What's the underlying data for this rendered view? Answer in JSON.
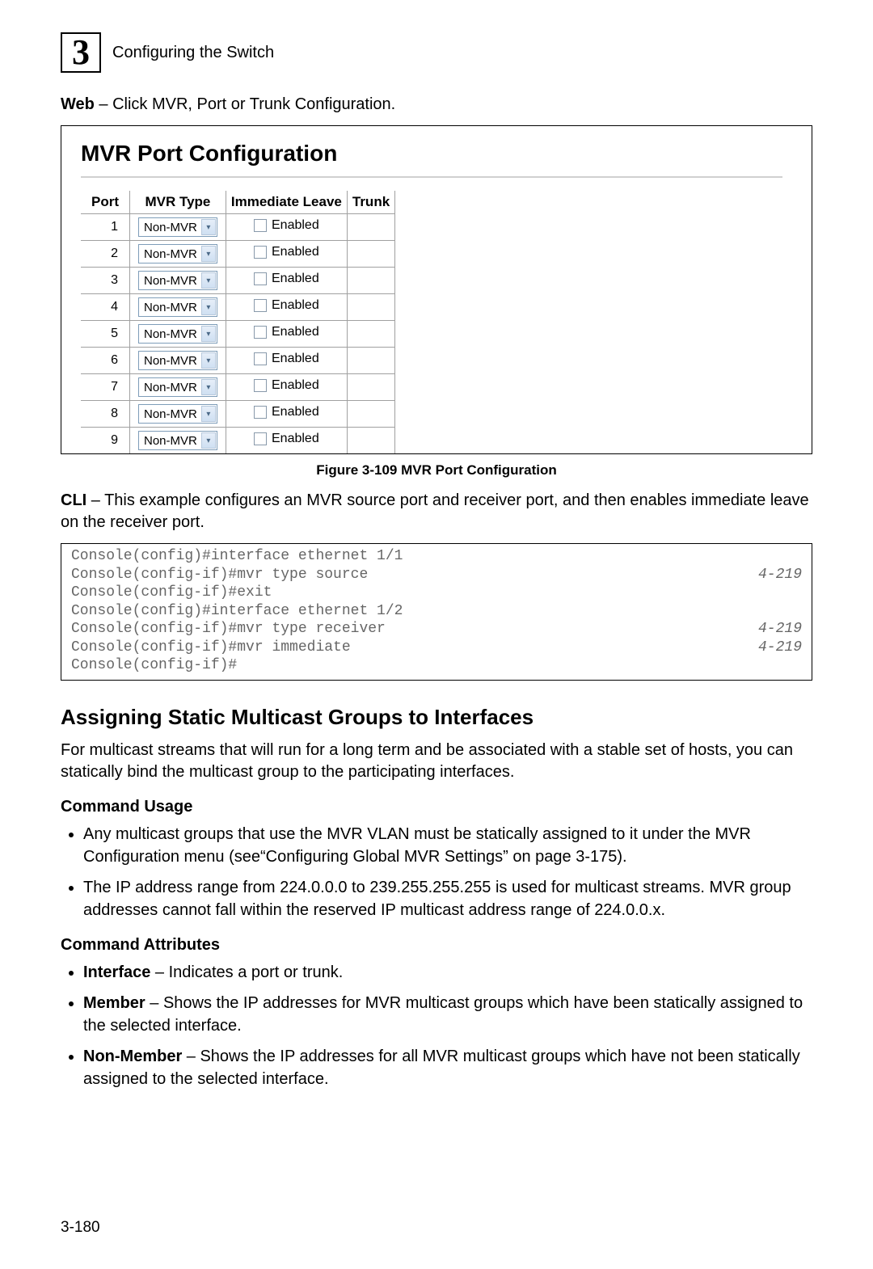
{
  "chapter_number": "3",
  "chapter_title": "Configuring the Switch",
  "web_line_bold": "Web",
  "web_line_rest": " – Click MVR, Port or Trunk Configuration.",
  "screenshot": {
    "title": "MVR Port Configuration",
    "headers": [
      "Port",
      "MVR Type",
      "Immediate Leave",
      "Trunk"
    ],
    "select_value": "Non-MVR",
    "checkbox_label": "Enabled",
    "rows": [
      {
        "port": "1"
      },
      {
        "port": "2"
      },
      {
        "port": "3"
      },
      {
        "port": "4"
      },
      {
        "port": "5"
      },
      {
        "port": "6"
      },
      {
        "port": "7"
      },
      {
        "port": "8"
      },
      {
        "port": "9"
      }
    ]
  },
  "figure_caption": "Figure 3-109  MVR Port Configuration",
  "cli_line_bold": "CLI",
  "cli_line_rest": " – This example configures an MVR source port and receiver port, and then enables immediate leave on the receiver port.",
  "cli_box": [
    {
      "text": "Console(config)#interface ethernet 1/1",
      "ref": ""
    },
    {
      "text": "Console(config-if)#mvr type source",
      "ref": "4-219"
    },
    {
      "text": "Console(config-if)#exit",
      "ref": ""
    },
    {
      "text": "Console(config)#interface ethernet 1/2",
      "ref": ""
    },
    {
      "text": "Console(config-if)#mvr type receiver",
      "ref": "4-219"
    },
    {
      "text": "Console(config-if)#mvr immediate",
      "ref": "4-219"
    },
    {
      "text": "Console(config-if)#",
      "ref": ""
    }
  ],
  "section_heading": "Assigning Static Multicast Groups to Interfaces",
  "section_body": "For multicast streams that will run for a long term and be associated with a stable set of hosts, you can statically bind the multicast group to the participating interfaces.",
  "command_usage_h": "Command Usage",
  "command_usage_items": [
    "Any multicast groups that use the MVR VLAN must be statically assigned to it under the MVR Configuration menu (see“Configuring Global MVR Settings” on page 3-175).",
    "The IP address range from 224.0.0.0 to 239.255.255.255 is used for multicast streams. MVR group addresses cannot fall within the reserved IP multicast address range of 224.0.0.x."
  ],
  "command_attributes_h": "Command Attributes",
  "command_attributes_items": [
    {
      "term": "Interface",
      "desc": " – Indicates a port or trunk."
    },
    {
      "term": "Member",
      "desc": " – Shows the IP addresses for MVR multicast groups which have been statically assigned to the selected interface."
    },
    {
      "term": "Non-Member",
      "desc": " – Shows the IP addresses for all MVR multicast groups which have not been statically assigned to the selected interface."
    }
  ],
  "page_number": "3-180"
}
